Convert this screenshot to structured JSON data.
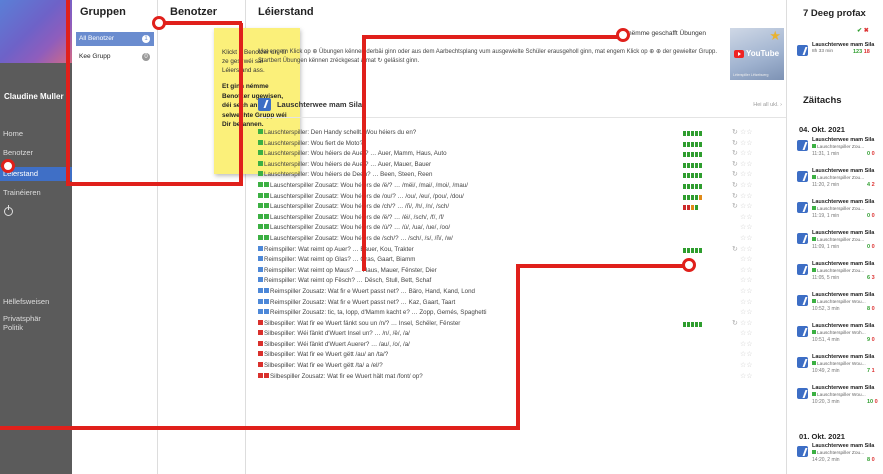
{
  "sidebar": {
    "user_name": "Claudine Muller",
    "nav": [
      {
        "label": "Home"
      },
      {
        "label": "Benotzer"
      },
      {
        "label": "Léierstand"
      },
      {
        "label": "Trainéieren"
      },
      {
        "label": "Hëllefsweisen"
      },
      {
        "label": "Privatsphär"
      },
      {
        "label": "Politik"
      }
    ]
  },
  "groups": {
    "title": "Gruppen",
    "items": [
      {
        "label": "All Benotzer",
        "count": "1"
      },
      {
        "label": "Kee Grupp",
        "count": "0"
      }
    ]
  },
  "users": {
    "title": "Benotzer",
    "tooltip_text": "Klickt e Benotzer un, fir ze gesi wéi säi Léierstand ass.",
    "tooltip_bold": "Et ginn némme Benotzer ugewisen, déi sech an de selwechte Grupp wéi Dir befannen."
  },
  "main": {
    "title": "Léierstand",
    "checkbox_label": "nëmme geschafft Übungen",
    "hint": "Mat engem Klick op ⊕ Übungen kënnen derbäi ginn oder aus dem Aarbechtsplang vum ausgewielte Schüler erausgeholl ginn, mat engem Klick op ⊕ ⊕ der gewielter Grupp. Startbert Übungen kënnen zréckgesat a mat ↻ geläsist ginn.",
    "youtube_label": "YouTube",
    "youtube_sub": "Léierspiller Lëtzebuerg",
    "lesson_title": "Lauschterwee mam Sila",
    "show_all": "Hei all ukl. ›",
    "exercises": [
      {
        "icon": "g",
        "text": "Lauschterspiller: Den Handy schellt. Wou héiers du en?",
        "bars": "ggggg"
      },
      {
        "icon": "g",
        "text": "Lauschterspiller: Wou fiert de Moto?",
        "bars": "ggggg"
      },
      {
        "icon": "g",
        "text": "Lauschterspiller: Wou héiers de Auer? … Auer, Mamm, Haus, Auto",
        "bars": "ggggg"
      },
      {
        "icon": "g",
        "text": "Lauschterspiller: Wou héiers de Auer? … Auer, Mauer, Bauer",
        "bars": "ggggg"
      },
      {
        "icon": "g",
        "text": "Lauschterspiller: Wou héiers de Deen? … Been, Steen, Reen",
        "bars": "ggggg"
      },
      {
        "icon": "gg",
        "text": "Lauschterspiller Zousatz: Wou héiers de /ë/? … /mëi/, /mai/, /moi/, /mau/",
        "bars": "ggggg"
      },
      {
        "icon": "gg",
        "text": "Lauschterspiller Zousatz: Wou héiers de /ou/? … /ou/, /eu/, /pou/, /dou/",
        "bars": "ggggo"
      },
      {
        "icon": "gg",
        "text": "Lauschterspiller Zousatz: Wou héiers de /ch/? … /ñ/, /h/, /n/, /sch/",
        "bars": "rrog"
      },
      {
        "icon": "gg",
        "text": "Lauschterspiller Zousatz: Wou héiers de /ë/? … /éi/, /sch/, /f/, /f/",
        "bars": ""
      },
      {
        "icon": "gg",
        "text": "Lauschterspiller Zousatz: Wou héiers de /ú/? … /ú/, /ua/, /ue/, /oo/",
        "bars": ""
      },
      {
        "icon": "gg",
        "text": "Lauschterspiller Zousatz: Wou héiers de /sch/? … /sch/, /s/, /ñ/, /w/",
        "bars": ""
      },
      {
        "icon": "b",
        "text": "Reimspiller: Wat reimt op Auer? … Bauer, Kou, Trakter",
        "bars": "ggggg"
      },
      {
        "icon": "b",
        "text": "Reimspiller: Wat reimt op Glas? … Gras, Gaart, Biamm",
        "bars": ""
      },
      {
        "icon": "b",
        "text": "Reimspiller: Wat reimt op Maus? … Haus, Mauer, Fënster, Dier",
        "bars": ""
      },
      {
        "icon": "b",
        "text": "Reimspiller: Wat reimt op Fësch? … Dësch, Stull, Bett, Schaf",
        "bars": ""
      },
      {
        "icon": "bb",
        "text": "Reimspiller Zousatz: Wat fir e Wuert passt net? … Bäro, Hand, Kand, Lond",
        "bars": ""
      },
      {
        "icon": "bb",
        "text": "Reimspiller Zousatz: Wat fir e Wuert passt net? … Kaz, Gaart, Taart",
        "bars": ""
      },
      {
        "icon": "bb",
        "text": "Reimspiller Zousatz: tic, ta, lopp, d'Mamm kacht e? … Zopp, Gemés, Spaghetti",
        "bars": ""
      },
      {
        "icon": "r",
        "text": "Silbespiller: Wat fir ee Wuert fänkt sou un /n/? … Insel, Schëler, Fënster",
        "bars": "ggggg"
      },
      {
        "icon": "r",
        "text": "Silbespiller: Wéi fänkt d'Wuert Insel un? … /n/, /ë/, /a/",
        "bars": ""
      },
      {
        "icon": "r",
        "text": "Silbespiller: Wéi fänkt d'Wuert Auerer? … /au/, /o/, /a/",
        "bars": ""
      },
      {
        "icon": "r",
        "text": "Silbespiller: Wat fir ee Wuert gëtt /au/ an /ta/?",
        "bars": ""
      },
      {
        "icon": "r",
        "text": "Silbespiller: Wat fir ee Wuert gëtt /ta/ a /el/?",
        "bars": ""
      },
      {
        "icon": "rr",
        "text": "Silbespiller Zousatz: Wat fir ee Wuert hält mat /font/ op?",
        "bars": ""
      }
    ]
  },
  "right": {
    "title_7days": "7 Deeg profax",
    "seven_day_item": {
      "name": "Lauschterwee mam Sila",
      "time": "8h 33 min",
      "score": "123",
      "wrong": "18"
    },
    "title_timeline": "Zäitachs",
    "date1": "04. Okt. 2021",
    "date2": "01. Okt. 2021",
    "activities": [
      {
        "name": "Lauschterwee mam Sila",
        "sub": "Lauschterspiller Zou...",
        "time": "11:31, 1 min",
        "ok": "0",
        "ko": "0"
      },
      {
        "name": "Lauschterwee mam Sila",
        "sub": "Lauschterspiller Zou...",
        "time": "11:20, 2 min",
        "ok": "4",
        "ko": "2"
      },
      {
        "name": "Lauschterwee mam Sila",
        "sub": "Lauschterspiller Zou...",
        "time": "11:19, 1 min",
        "ok": "0",
        "ko": "0"
      },
      {
        "name": "Lauschterwee mam Sila",
        "sub": "Lauschterspiller Zou...",
        "time": "11:09, 1 min",
        "ok": "0",
        "ko": "0"
      },
      {
        "name": "Lauschterwee mam Sila",
        "sub": "Lauschterspiller Zou...",
        "time": "11:05, 5 min",
        "ok": "6",
        "ko": "3"
      },
      {
        "name": "Lauschterwee mam Sila",
        "sub": "Lauschterspiller Wou...",
        "time": "10:52, 3 min",
        "ok": "8",
        "ko": "0"
      },
      {
        "name": "Lauschterwee mam Sila",
        "sub": "Lauschterspiller Woh...",
        "time": "10:51, 4 min",
        "ok": "9",
        "ko": "0"
      },
      {
        "name": "Lauschterwee mam Sila",
        "sub": "Lauschterspiller Wou...",
        "time": "10:49, 2 min",
        "ok": "7",
        "ko": "1"
      },
      {
        "name": "Lauschterwee mam Sila",
        "sub": "Lauschterspiller Wou...",
        "time": "10:20, 3 min",
        "ok": "10",
        "ko": "0"
      },
      {
        "name": "Lauschterwee mam Sila",
        "sub": "Lauschterspiller Zou...",
        "time": "14:20, 2 min",
        "ok": "8",
        "ko": "0"
      }
    ]
  },
  "colors": {
    "accent": "#3f6fc6",
    "annotation": "#e0201b",
    "tooltip": "#fbf07a"
  }
}
